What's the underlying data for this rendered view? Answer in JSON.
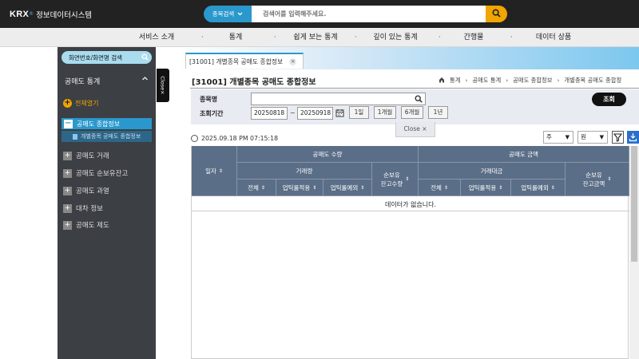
{
  "header": {
    "logo_text": "KRX",
    "logo_sup": "®",
    "system_name": "정보데이터시스템",
    "search_type": "종목검색",
    "search_placeholder": "검색어를 입력해주세요."
  },
  "nav": [
    "서비스 소개",
    "통계",
    "쉽게 보는 통계",
    "깊이 있는 통계",
    "간행물",
    "데이터 상품"
  ],
  "nav_separator": "·",
  "sidebar": {
    "search_label": "화면번호/화면명 검색",
    "close_tab": "Close×",
    "section_title": "공매도 통계",
    "open_all": "전체열기",
    "active_item": "공매도 종합정보",
    "active_sub_item": "개별종목 공매도 종합정보",
    "items": [
      "공매도 거래",
      "공매도 순보유잔고",
      "공매도 과열",
      "대차 정보",
      "공매도 제도"
    ]
  },
  "tab": {
    "label": "[31001] 개별종목 공매도 종합정보"
  },
  "page": {
    "title": "[31001] 개별종목 공매도 종합정보",
    "breadcrumb": [
      "통계",
      "공매도 통계",
      "공매도 종합정보",
      "개별종목 공매도 종합정"
    ]
  },
  "form": {
    "stock_label": "종목명",
    "period_label": "조회기간",
    "date_from": "20250818",
    "date_sep": "~",
    "date_to": "20250918",
    "period_buttons": [
      "1일",
      "1개월",
      "6개월",
      "1년"
    ],
    "lookup_button": "조회",
    "close_popup": "Close ×"
  },
  "toolbar": {
    "timestamp": "2025.09.18 PM 07:15:18",
    "period_select": "주",
    "unit_select": "원"
  },
  "table": {
    "col_date": "일자",
    "group_volume": "공매도 수량",
    "group_amount": "공매도 금액",
    "volume_sub": "거래량",
    "amount_sub": "거래대금",
    "net_volume": "순보유\n잔고수량",
    "net_amount": "순보유\n잔고금액",
    "cols_total": "전체",
    "cols_uptick_applied": "업틱룰적용",
    "cols_uptick_exempt": "업틱룰예외",
    "empty_message": "데이터가 없습니다."
  },
  "colors": {
    "topbar": "#222222",
    "accent": "#2a98cc",
    "search_button": "#f0a500",
    "table_header": "#5b6e87"
  }
}
